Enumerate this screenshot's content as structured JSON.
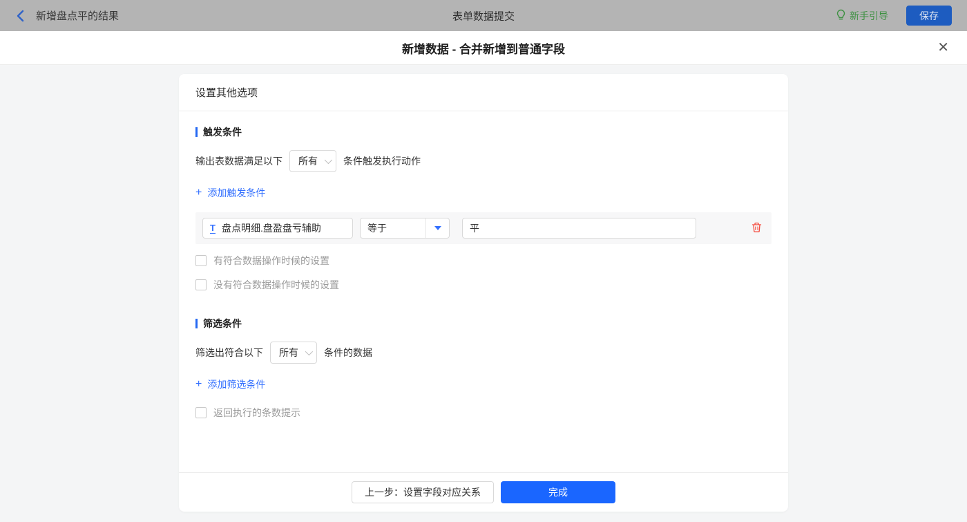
{
  "topbar": {
    "back_label": "新增盘点平的结果",
    "title": "表单数据提交",
    "guide_label": "新手引导",
    "save_label": "保存"
  },
  "dialog": {
    "title": "新增数据 - 合并新增到普通字段",
    "close_glyph": "✕"
  },
  "card": {
    "header": "设置其他选项",
    "trigger_section": {
      "title": "触发条件",
      "sentence_prefix": "输出表数据满足以下",
      "match_select_value": "所有",
      "sentence_suffix": "条件触发执行动作",
      "add_icon": "+",
      "add_link": "添加触发条件",
      "condition": {
        "field_type_glyph": "T",
        "field_value": "盘点明细.盘盈盘亏辅助",
        "operator_value": "等于",
        "value": "平"
      },
      "checkbox_has_match": "有符合数据操作时候的设置",
      "checkbox_no_match": "没有符合数据操作时候的设置"
    },
    "filter_section": {
      "title": "筛选条件",
      "sentence_prefix": "筛选出符合以下",
      "match_select_value": "所有",
      "sentence_suffix": "条件的数据",
      "add_icon": "+",
      "add_link": "添加筛选条件",
      "checkbox_count_tip": "返回执行的条数提示"
    },
    "footer": {
      "prev_label": "上一步：设置字段对应关系",
      "finish_label": "完成"
    }
  },
  "colors": {
    "accent_blue": "#3370ff",
    "primary_button_blue": "#1a66ff",
    "section_bar_blue": "#2468f2",
    "guide_green": "#3f9143",
    "danger_red": "#f5483b",
    "dimmed_topbar_gray": "#b4b4b4",
    "content_background": "#f4f5f6"
  }
}
